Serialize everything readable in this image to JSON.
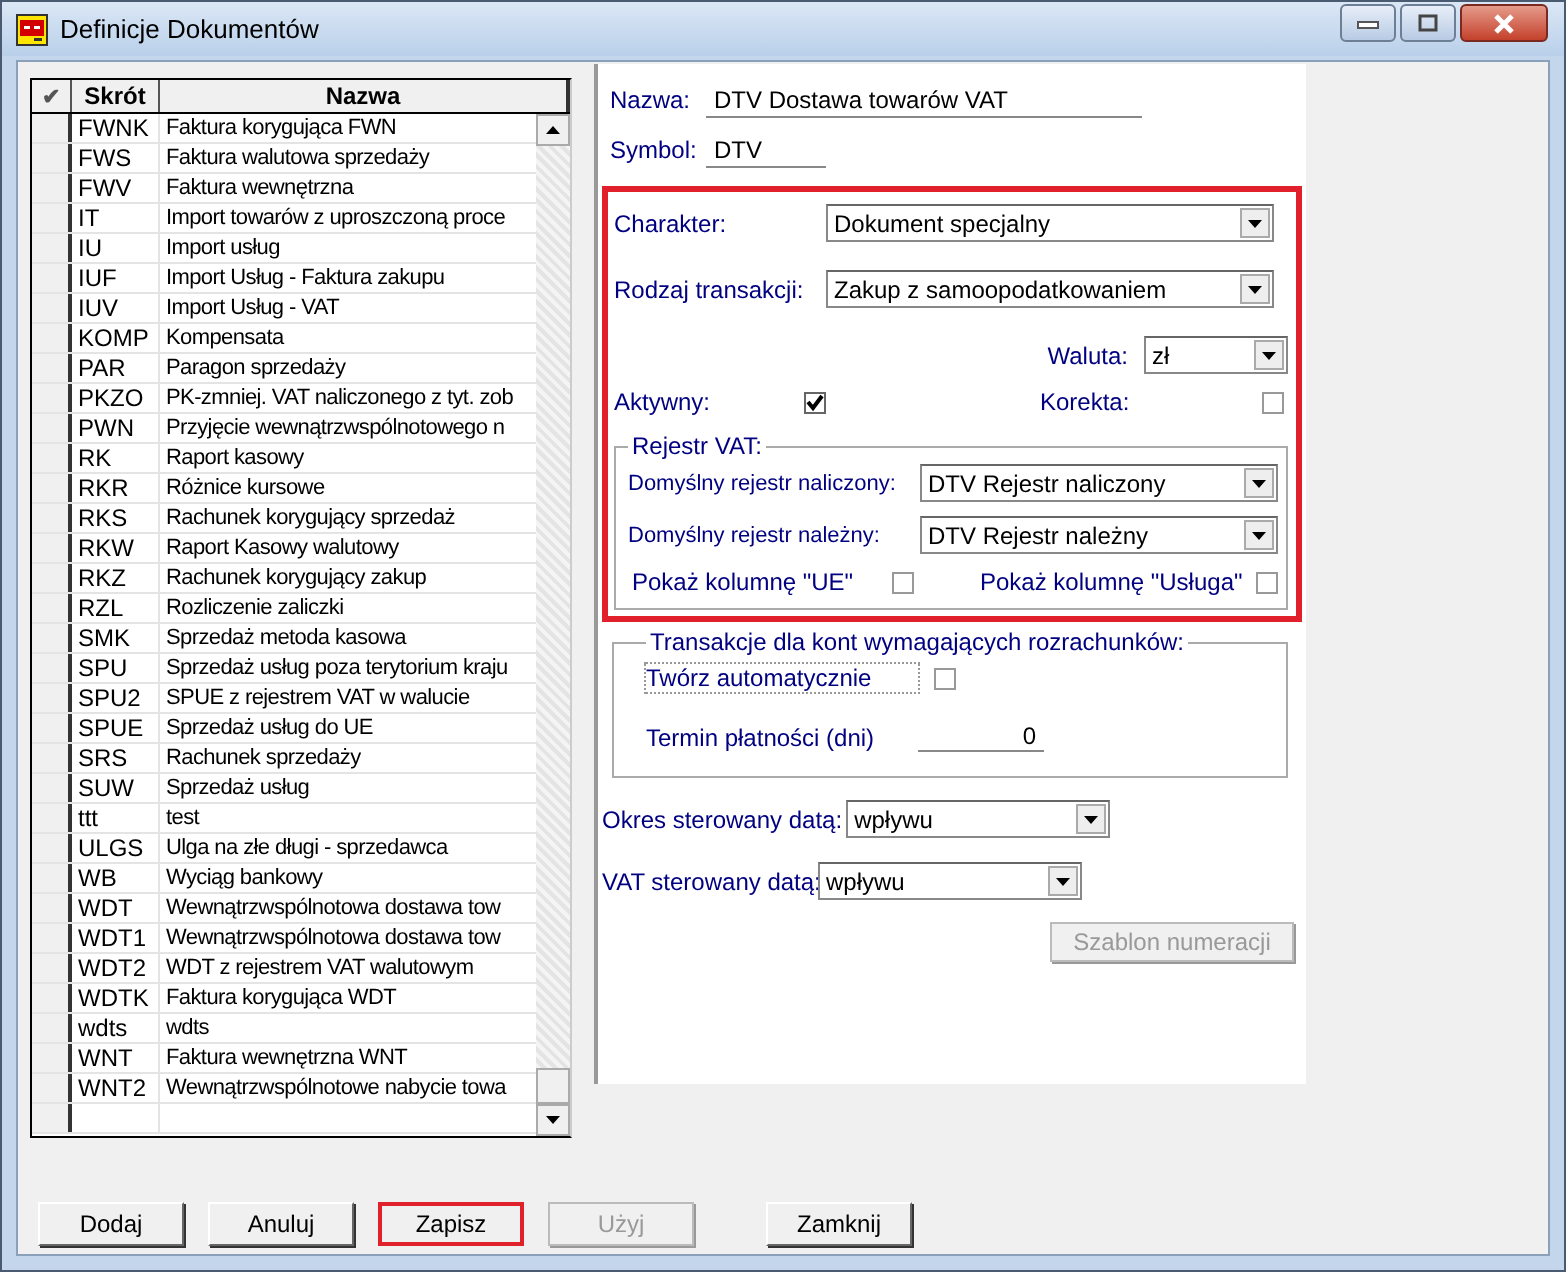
{
  "window": {
    "title": "Definicje Dokumentów"
  },
  "table": {
    "check_header": "✔",
    "columns": [
      "Skrót",
      "Nazwa"
    ],
    "rows": [
      {
        "code": "FWNK",
        "name": "Faktura korygująca FWN"
      },
      {
        "code": "FWS",
        "name": "Faktura walutowa sprzedaży"
      },
      {
        "code": "FWV",
        "name": "Faktura wewnętrzna"
      },
      {
        "code": "IT",
        "name": "Import towarów z uproszczoną proce"
      },
      {
        "code": "IU",
        "name": "Import usług"
      },
      {
        "code": "IUF",
        "name": "Import Usług - Faktura zakupu"
      },
      {
        "code": "IUV",
        "name": "Import Usług - VAT"
      },
      {
        "code": "KOMP",
        "name": "Kompensata"
      },
      {
        "code": "PAR",
        "name": "Paragon sprzedaży"
      },
      {
        "code": "PKZO",
        "name": "PK-zmniej. VAT naliczonego z tyt. zob"
      },
      {
        "code": "PWN",
        "name": "Przyjęcie wewnątrzwspólnotowego n"
      },
      {
        "code": "RK",
        "name": "Raport kasowy"
      },
      {
        "code": "RKR",
        "name": "Różnice kursowe"
      },
      {
        "code": "RKS",
        "name": "Rachunek korygujący sprzedaż"
      },
      {
        "code": "RKW",
        "name": "Raport Kasowy walutowy"
      },
      {
        "code": "RKZ",
        "name": "Rachunek korygujący zakup"
      },
      {
        "code": "RZL",
        "name": "Rozliczenie zaliczki"
      },
      {
        "code": "SMK",
        "name": "Sprzedaż metoda kasowa"
      },
      {
        "code": "SPU",
        "name": "Sprzedaż usług poza terytorium kraju"
      },
      {
        "code": "SPU2",
        "name": "SPUE z rejestrem VAT w walucie"
      },
      {
        "code": "SPUE",
        "name": "Sprzedaż usług do UE"
      },
      {
        "code": "SRS",
        "name": "Rachunek sprzedaży"
      },
      {
        "code": "SUW",
        "name": "Sprzedaż usług"
      },
      {
        "code": "ttt",
        "name": "test"
      },
      {
        "code": "ULGS",
        "name": "Ulga na złe długi - sprzedawca"
      },
      {
        "code": "WB",
        "name": "Wyciąg bankowy"
      },
      {
        "code": "WDT",
        "name": "Wewnątrzwspólnotowa dostawa tow"
      },
      {
        "code": "WDT1",
        "name": "Wewnątrzwspólnotowa dostawa tow"
      },
      {
        "code": "WDT2",
        "name": "WDT z rejestrem VAT walutowym"
      },
      {
        "code": "WDTK",
        "name": "Faktura korygująca WDT"
      },
      {
        "code": "wdts",
        "name": "wdts"
      },
      {
        "code": "WNT",
        "name": "Faktura wewnętrzna WNT"
      },
      {
        "code": "WNT2",
        "name": "Wewnątrzwspólnotowe nabycie towa"
      }
    ]
  },
  "form": {
    "nazwa": {
      "label": "Nazwa:",
      "value": "DTV Dostawa towarów VAT"
    },
    "symbol": {
      "label": "Symbol:",
      "value": "DTV"
    },
    "vat_section": {
      "highlighted": true,
      "charakter": {
        "label": "Charakter:",
        "value": "Dokument specjalny"
      },
      "rodzaj": {
        "label": "Rodzaj transakcji:",
        "value": "Zakup z samoopodatkowaniem"
      },
      "waluta": {
        "label": "Waluta:",
        "value": "zł"
      },
      "aktywny": {
        "label": "Aktywny:",
        "checked": true
      },
      "korekta": {
        "label": "Korekta:",
        "checked": false
      },
      "rejestr": {
        "title": "Rejestr VAT:",
        "naliczony": {
          "label": "Domyślny rejestr naliczony:",
          "value": "DTV Rejestr naliczony"
        },
        "nalezny": {
          "label": "Domyślny rejestr należny:",
          "value": "DTV Rejestr należny"
        },
        "ue": {
          "label": "Pokaż kolumnę \"UE\"",
          "checked": false
        },
        "usluga": {
          "label": "Pokaż kolumnę \"Usługa\"",
          "checked": false
        }
      }
    },
    "rozrachunki": {
      "title": "Transakcje dla kont wymagających rozrachunków:",
      "tworz": {
        "label": "Twórz automatycznie",
        "checked": false
      },
      "termin": {
        "label": "Termin płatności (dni)",
        "value": "0"
      }
    },
    "okres": {
      "label": "Okres sterowany datą:",
      "value": "wpływu"
    },
    "vat_data": {
      "label": "VAT sterowany datą:",
      "value": "wpływu"
    },
    "szablon": {
      "label": "Szablon numeracji",
      "disabled": true
    }
  },
  "buttons": [
    {
      "label": "Dodaj",
      "disabled": false,
      "highlighted": false
    },
    {
      "label": "Anuluj",
      "disabled": false,
      "highlighted": false
    },
    {
      "label": "Zapisz",
      "disabled": false,
      "highlighted": true
    },
    {
      "label": "Użyj",
      "disabled": true,
      "highlighted": false
    },
    {
      "label": "Zamknij",
      "disabled": false,
      "highlighted": false
    }
  ]
}
